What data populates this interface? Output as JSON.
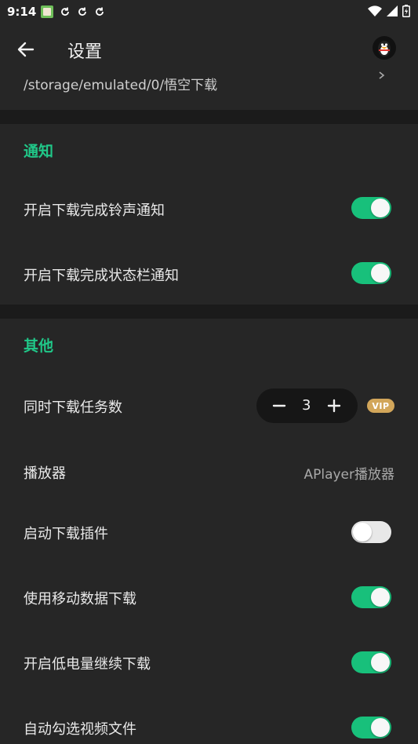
{
  "statusbar": {
    "time": "9:14"
  },
  "appbar": {
    "title": "设置"
  },
  "storage": {
    "path": "/storage/emulated/0/悟空下载"
  },
  "notify": {
    "title": "通知",
    "ring_label": "开启下载完成铃声通知",
    "ring_on": true,
    "statusbar_label": "开启下载完成状态栏通知",
    "statusbar_on": true
  },
  "other": {
    "title": "其他",
    "concurrent_label": "同时下载任务数",
    "concurrent_value": "3",
    "vip_badge": "VIP",
    "player_label": "播放器",
    "player_value": "APlayer播放器",
    "plugin_label": "启动下载插件",
    "plugin_on": false,
    "mobile_label": "使用移动数据下载",
    "mobile_on": true,
    "lowpower_label": "开启低电量继续下载",
    "lowpower_on": true,
    "autoselect_label": "自动勾选视频文件",
    "autoselect_on": true
  },
  "colors": {
    "accent": "#20c788",
    "toggle_on": "#18c07b",
    "vip": "#d2a65a"
  }
}
